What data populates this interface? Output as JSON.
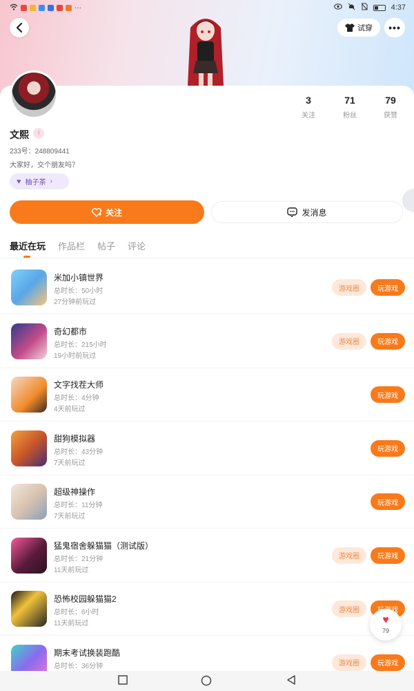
{
  "status_bar": {
    "time": "4:37"
  },
  "header": {
    "tryon_label": "试穿"
  },
  "profile": {
    "name": "文熙",
    "uid": "233号：248809441",
    "bio": "大家好，交个朋友吗？",
    "tag": "柚子茶",
    "stats": [
      {
        "value": "3",
        "label": "关注"
      },
      {
        "value": "71",
        "label": "粉丝"
      },
      {
        "value": "79",
        "label": "获赞"
      }
    ]
  },
  "actions": {
    "follow": "关注",
    "message": "发消息"
  },
  "tabs": [
    "最近在玩",
    "作品栏",
    "帖子",
    "评论"
  ],
  "games": [
    {
      "title": "米加小镇世界",
      "duration": "总时长：50小时",
      "last_played": "27分钟前玩过",
      "has_circle": true
    },
    {
      "title": "奇幻都市",
      "duration": "总时长：215小时",
      "last_played": "19小时前玩过",
      "has_circle": true
    },
    {
      "title": "文字找茬大师",
      "duration": "总时长：4分钟",
      "last_played": "4天前玩过",
      "has_circle": false
    },
    {
      "title": "甜狗模拟器",
      "duration": "总时长：43分钟",
      "last_played": "7天前玩过",
      "has_circle": false
    },
    {
      "title": "超级神操作",
      "duration": "总时长：11分钟",
      "last_played": "7天前玩过",
      "has_circle": false
    },
    {
      "title": "猛鬼宿舍躲猫猫（测试版）",
      "duration": "总时长：21分钟",
      "last_played": "11天前玩过",
      "has_circle": true
    },
    {
      "title": "恐怖校园躲猫猫2",
      "duration": "总时长：6小时",
      "last_played": "11天前玩过",
      "has_circle": true
    },
    {
      "title": "期末考试换装跑酷",
      "duration": "总时长：36分钟",
      "last_played": "",
      "has_circle": true
    }
  ],
  "buttons": {
    "circle": "游戏圈",
    "play": "玩游戏"
  },
  "like_float": {
    "count": "79"
  },
  "colors": {
    "accent": "#f97a1a",
    "circle_bg": "#fde8d9",
    "tag_bg": "#efe9fb"
  }
}
